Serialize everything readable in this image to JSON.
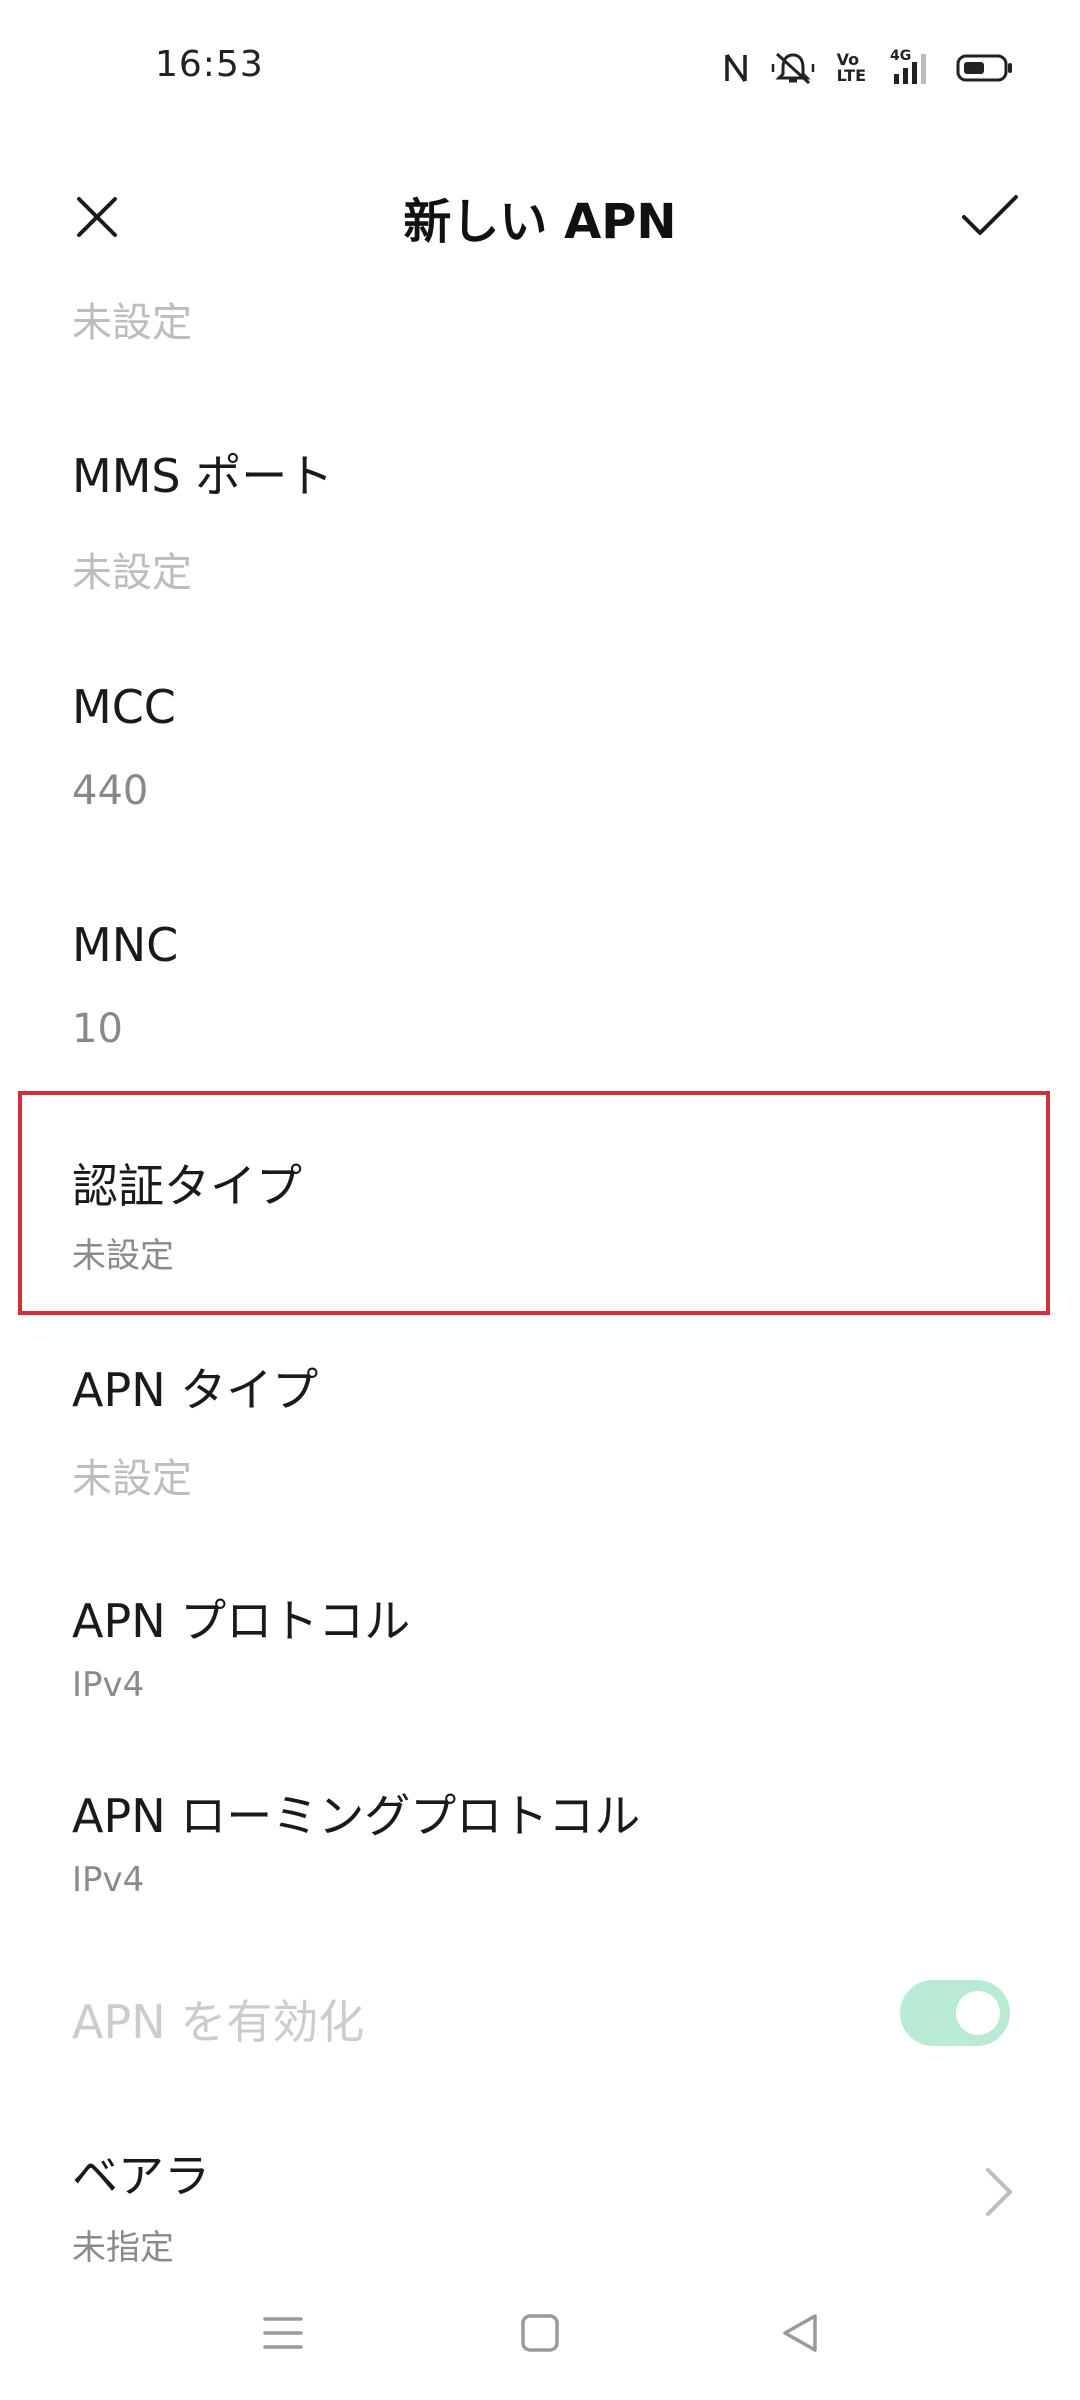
{
  "status_bar": {
    "time": "16:53",
    "icons": [
      "nfc-icon",
      "mute-icon",
      "volte-icon",
      "signal-4g-icon",
      "battery-icon"
    ],
    "volte_top": "Vo",
    "volte_bottom": "LTE",
    "network_label": "4G"
  },
  "header": {
    "title": "新しい APN",
    "close_icon": "close-icon",
    "confirm_icon": "check-icon"
  },
  "items": [
    {
      "title": "",
      "value": "未設定"
    },
    {
      "title": "MMS ポート",
      "value": "未設定"
    },
    {
      "title": "MCC",
      "value": "440"
    },
    {
      "title": "MNC",
      "value": "10"
    },
    {
      "title": "認証タイプ",
      "value": "未設定"
    },
    {
      "title": "APN タイプ",
      "value": "未設定"
    },
    {
      "title": "APN プロトコル",
      "value": "IPv4"
    },
    {
      "title": "APN ローミングプロトコル",
      "value": "IPv4"
    },
    {
      "title": "APN を有効化",
      "enabled": false,
      "toggle_on": true
    },
    {
      "title": "ベアラ",
      "value": "未指定"
    }
  ],
  "colors": {
    "highlight": "#d32f3a",
    "toggle_on": "#b9ead4"
  },
  "nav_bar": {
    "icons": [
      "menu-icon",
      "home-icon",
      "back-icon"
    ]
  }
}
